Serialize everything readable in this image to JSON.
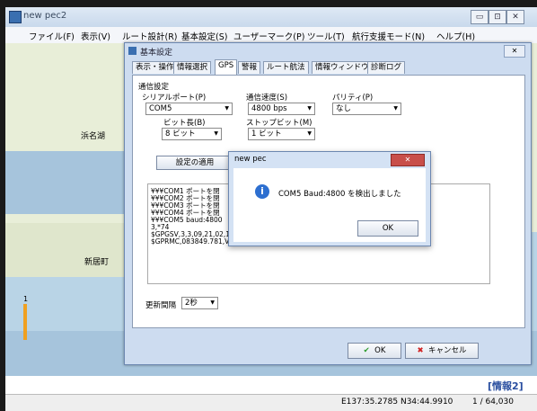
{
  "app": {
    "title": "new pec2",
    "menu": [
      "ファイル(F)",
      "表示(V)",
      "ルート設計(R)",
      "基本設定(S)",
      "ユーザーマーク(P)",
      "ツール(T)",
      "航行支援モード(N)",
      "ヘルプ(H)"
    ],
    "caption_buttons": [
      "▭",
      "⊡",
      "✕"
    ]
  },
  "map": {
    "labels": [
      "浜名湖",
      "新居町"
    ],
    "scale_mark": "1",
    "info_badge": "[情報2]"
  },
  "status": {
    "coords": "E137:35.2785 N34:44.9910",
    "scale": "1 / 64,030"
  },
  "dialog": {
    "title": "基本設定",
    "close": "✕",
    "tabs": [
      "表示・操作",
      "情報選択",
      "GPS",
      "警報",
      "ルート航法",
      "情報ウィンドウ",
      "診断ログ"
    ],
    "section": "通信設定",
    "serial_label": "シリアルポート(P)",
    "serial_value": "COM5",
    "speed_label": "通信速度(S)",
    "speed_value": "4800 bps",
    "parity_label": "パリティ(P)",
    "parity_value": "なし",
    "bits_label": "ビット長(B)",
    "bits_value": "8 ビット",
    "stop_label": "ストップビット(M)",
    "stop_value": "1 ビット",
    "apply_button": "設定の適用",
    "log_lines": [
      "¥¥¥COM1 ポートを閉",
      "¥¥¥COM2 ポートを閉",
      "¥¥¥COM3 ポートを閉",
      "¥¥¥COM4 ポートを閉",
      "¥¥¥COM5 baud:4800",
      "3,*74",
      "$GPGSV,3,3,09,21,02,1",
      "$GPRMC,083849.781,V"
    ],
    "interval_label": "更新間隔",
    "interval_value": "2秒",
    "ok_label": "OK",
    "cancel_label": "キャンセル"
  },
  "message": {
    "title": "new pec",
    "text": "COM5 Baud:4800 を検出しました",
    "ok": "OK"
  }
}
